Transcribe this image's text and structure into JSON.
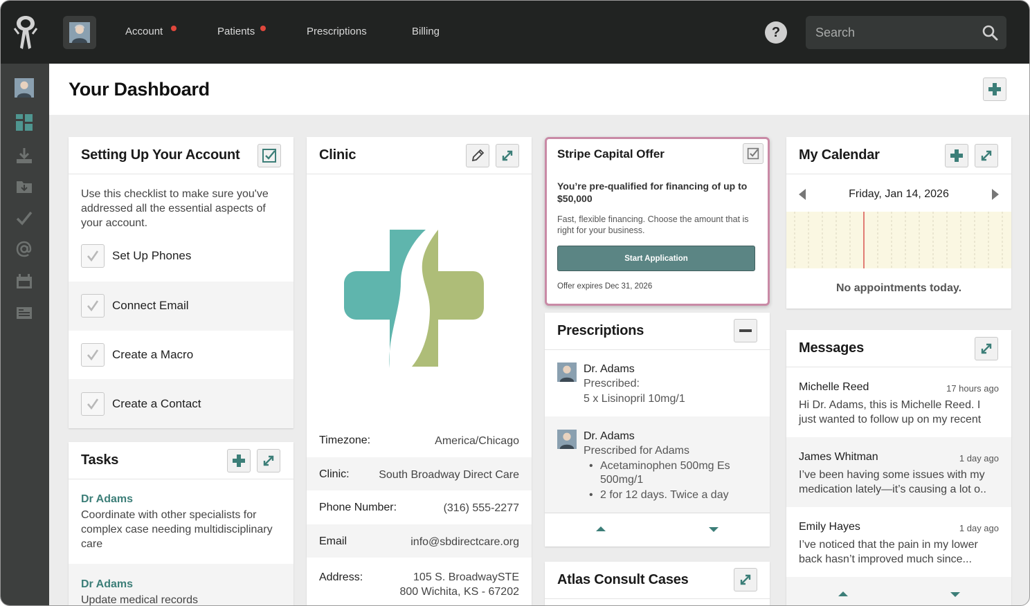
{
  "nav": {
    "items": [
      {
        "label": "Account",
        "dot": true
      },
      {
        "label": "Patients",
        "dot": true
      },
      {
        "label": "Prescriptions",
        "dot": false
      },
      {
        "label": "Billing",
        "dot": false
      }
    ],
    "help_label": "?",
    "search_placeholder": "Search"
  },
  "sidebar_icons": [
    "user-avatar",
    "dashboard-icon",
    "download-icon",
    "folder-icon",
    "check-icon",
    "at-icon",
    "calendar-icon",
    "newspaper-icon"
  ],
  "header": {
    "title": "Your Dashboard"
  },
  "setup": {
    "title": "Setting Up Your  Account",
    "description": "Use this checklist to make sure you've addressed all the essential aspects of your account.",
    "items": [
      "Set Up Phones",
      "Connect Email",
      "Create a Macro",
      "Create a Contact"
    ]
  },
  "tasks": {
    "title": "Tasks",
    "items": [
      {
        "author": "Dr Adams",
        "text": "Coordinate with other specialists for complex case needing multidisciplinary care"
      },
      {
        "author": "Dr Adams",
        "text": "Update medical records"
      }
    ]
  },
  "clinic": {
    "title": "Clinic",
    "fields": [
      {
        "label": "Timezone:",
        "value": "America/Chicago"
      },
      {
        "label": "Clinic:",
        "value": "South Broadway Direct Care"
      },
      {
        "label": "Phone Number:",
        "value": "(316) 555-2277"
      },
      {
        "label": "Email",
        "value": "info@sbdirectcare.org"
      },
      {
        "label": "Address:",
        "value": "105 S. BroadwaySTE",
        "value2": "800 Wichita, KS - 67202"
      }
    ]
  },
  "stripe": {
    "title": "Stripe Capital Offer",
    "headline": "You’re pre-qualified for financing of up to $50,000",
    "body": "Fast, flexible financing. Choose the amount that is right for your business.",
    "button": "Start Application",
    "expires": "Offer expires Dec 31, 2026"
  },
  "prescriptions": {
    "title": "Prescriptions",
    "items": [
      {
        "doctor": "Dr. Adams",
        "label": "Prescribed:",
        "detail": "5 x Lisinopril 10mg/1"
      },
      {
        "doctor": "Dr. Adams",
        "label": "Prescribed for Adams",
        "bullets": [
          "Acetaminophen 500mg Es",
          "500mg/1",
          "2 for 12 days. Twice a day"
        ]
      }
    ]
  },
  "atlas": {
    "title": "Atlas Consult Cases"
  },
  "calendar": {
    "title": "My Calendar",
    "date": "Friday, Jan 14, 2026",
    "empty": "No appointments today."
  },
  "messages": {
    "title": "Messages",
    "items": [
      {
        "name": "Michelle Reed",
        "time": "17 hours ago",
        "text": "Hi Dr. Adams, this is Michelle Reed. I just wanted to follow up on my recent"
      },
      {
        "name": "James Whitman",
        "time": "1 day ago",
        "text": "I’ve been having some issues with my medication lately—it’s causing a lot o.."
      },
      {
        "name": "Emily Hayes",
        "time": "1 day ago",
        "text": "I’ve noticed that the pain in my lower back hasn’t improved much since..."
      }
    ]
  },
  "colors": {
    "topbar": "#212322",
    "sidebar": "#3d3f3e",
    "accent": "#3c7e78",
    "notification": "#e0473c",
    "stripe_border": "#c98aa6",
    "stripe_button": "#5b8584"
  }
}
